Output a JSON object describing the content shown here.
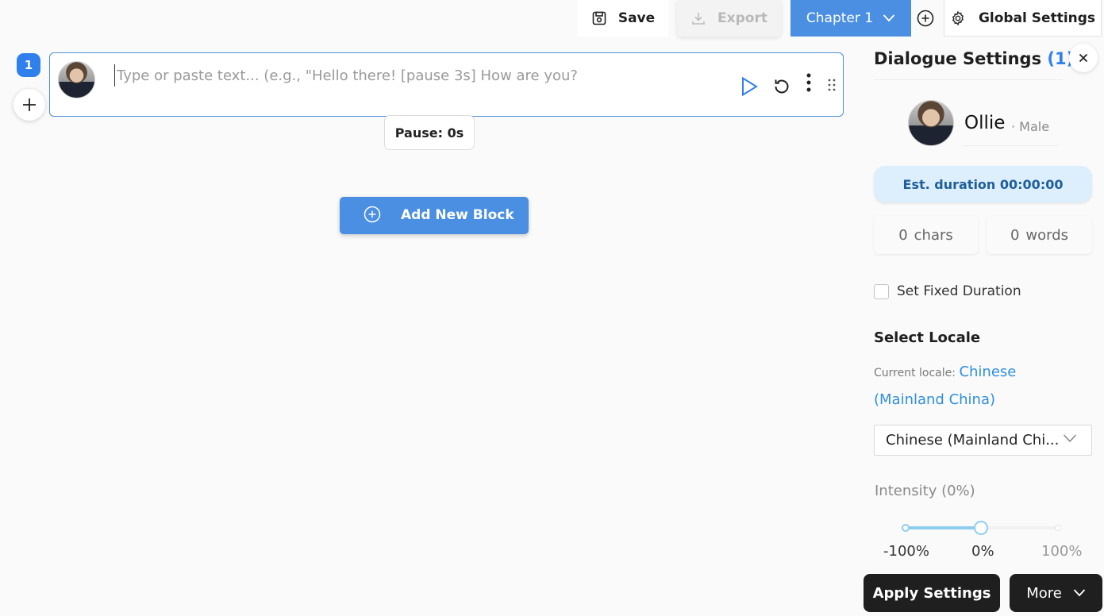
{
  "toolbar": {
    "save_label": "Save",
    "export_label": "Export",
    "chapter_label": "Chapter 1",
    "global_settings_label": "Global Settings"
  },
  "block": {
    "number": "1",
    "placeholder": "Type or paste text... (e.g., \"Hello there! [pause 3s] How are you?",
    "text": "",
    "pause_label": "Pause: 0s"
  },
  "add_block_label": "Add New Block",
  "panel": {
    "title": "Dialogue Settings",
    "count": "(1)",
    "voice": {
      "name": "Ollie",
      "gender": "· Male"
    },
    "est_duration": "Est. duration 00:00:00",
    "chars": {
      "value": "0",
      "label": "chars"
    },
    "words": {
      "value": "0",
      "label": "words"
    },
    "fixed_duration_label": "Set Fixed Duration",
    "fixed_duration_checked": false,
    "locale": {
      "title": "Select Locale",
      "current_prefix": "Current locale:",
      "current_value": "Chinese (Mainland China)",
      "selected": "Chinese (Mainland Chi..."
    },
    "intensity": {
      "label": "Intensity (0%)",
      "value": 0,
      "min": -100,
      "max": 100,
      "tick_min": "-100%",
      "tick_mid": "0%",
      "tick_max": "100%"
    }
  },
  "footer": {
    "apply_label": "Apply Settings",
    "more_label": "More"
  },
  "colors": {
    "accent": "#4a8fe2",
    "badge": "#2f80ed",
    "link": "#2f8fe0",
    "slider": "#8fcdef",
    "dark_button": "#1f1f1f"
  }
}
